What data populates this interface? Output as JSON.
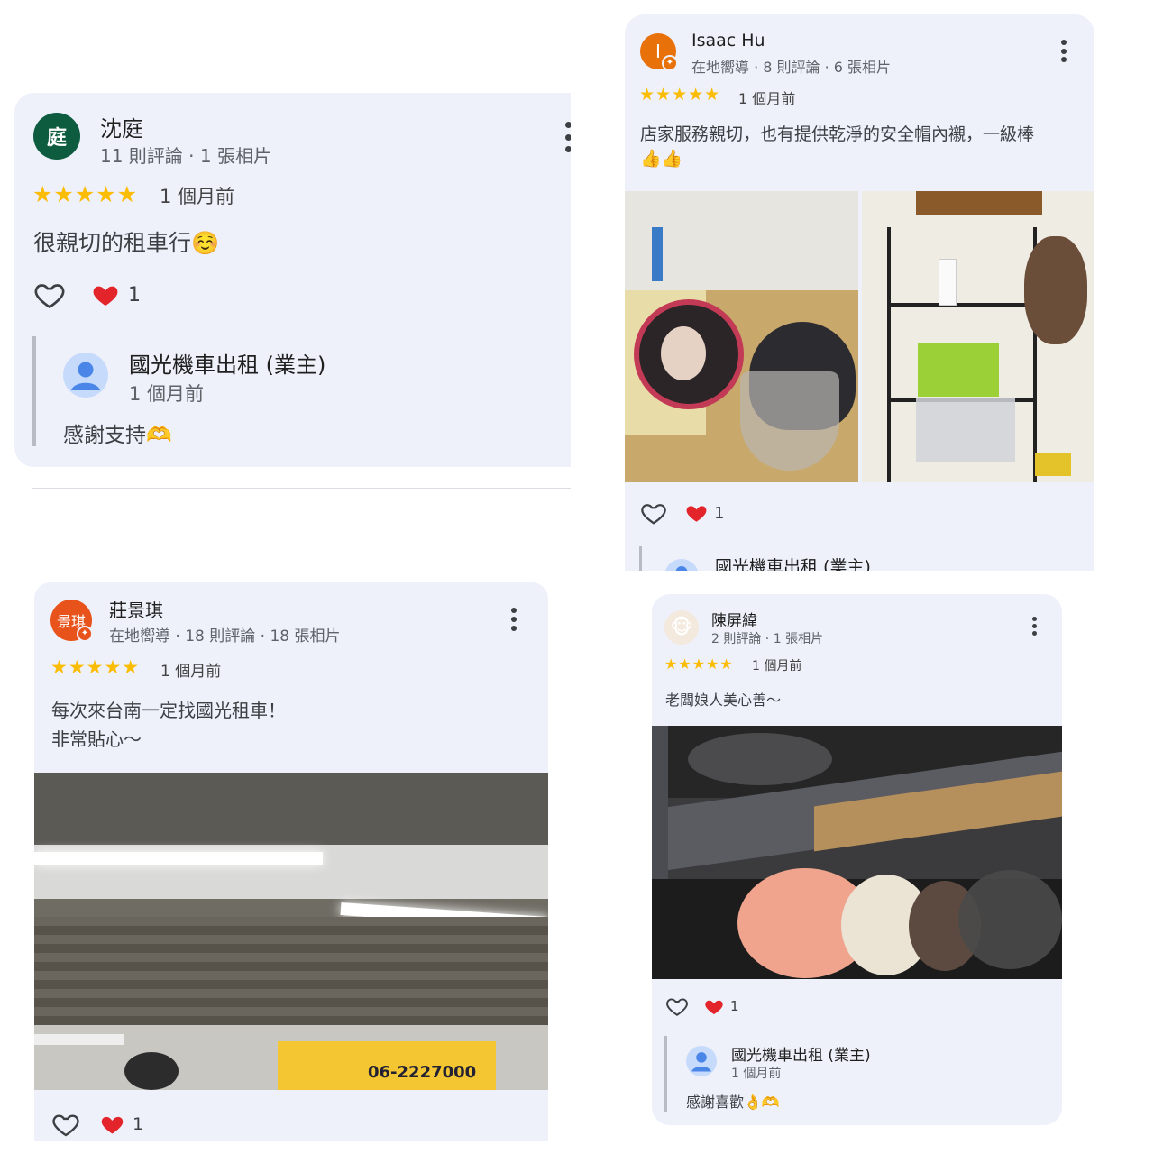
{
  "review1": {
    "avatar_text": "庭",
    "avatar_color": "#0d5c3f",
    "name": "沈庭",
    "meta": "11 則評論 · 1 張相片",
    "stars": "★★★★★",
    "time": "1 個月前",
    "text": "很親切的租車行☺️",
    "like_count": "1",
    "reply": {
      "name": "國光機車出租 (業主)",
      "time": "1 個月前",
      "text": "感謝支持🫶"
    }
  },
  "review2": {
    "avatar_text": "I",
    "avatar_color": "#e8710a",
    "name": "Isaac Hu",
    "meta": "在地嚮導 · 8 則評論 · 6 張相片",
    "stars": "★★★★★",
    "time": "1 個月前",
    "text_line1": "店家服務親切，也有提供乾淨的安全帽內襯，一級棒",
    "text_line2": "👍👍",
    "like_count": "1",
    "reply": {
      "name": "國光機車出租 (業主)"
    }
  },
  "review3": {
    "avatar_text": "景琪",
    "avatar_color": "#e8531b",
    "name": "莊景琪",
    "meta": "在地嚮導 · 18 則評論 · 18 張相片",
    "stars": "★★★★★",
    "time": "1 個月前",
    "text_line1": "每次來台南一定找國光租車！",
    "text_line2": "非常貼心～",
    "photo_sign_text": "06-2227000",
    "like_count": "1"
  },
  "review4": {
    "avatar_text": "🐵",
    "avatar_color": "#f3e9dd",
    "name": "陳屏緯",
    "meta": "2 則評論 · 1 張相片",
    "stars": "★★★★★",
    "time": "1 個月前",
    "text": "老闆娘人美心善～",
    "like_count": "1",
    "reply": {
      "name": "國光機車出租 (業主)",
      "time": "1 個月前",
      "text": "感謝喜歡👌🫶"
    }
  },
  "colors": {
    "star": "#fbbc04",
    "heart": "#e3242b",
    "card_bg": "#eef0fa"
  },
  "icons": [
    "heart-outline-icon",
    "heart-red-icon",
    "more-vert-icon",
    "owner-avatar-icon",
    "local-guide-badge-icon"
  ]
}
